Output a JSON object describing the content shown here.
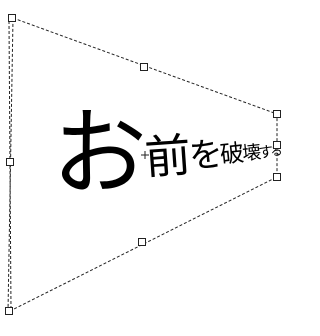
{
  "canvas": {
    "background": "#ffffff",
    "ink_color": "#000000",
    "frame_color": "#222222"
  },
  "text_layer": {
    "text": "お前を破壊する",
    "glyphs": [
      "お",
      "前",
      "を",
      "破",
      "壊",
      "す",
      "る"
    ]
  },
  "transform_box": {
    "mode": "perspective",
    "handle_names": [
      "top-left",
      "top-middle",
      "top-right",
      "right-middle",
      "bottom-right",
      "bottom-middle",
      "bottom-left",
      "left-middle"
    ],
    "pivot_icon": "crosshair-icon"
  }
}
